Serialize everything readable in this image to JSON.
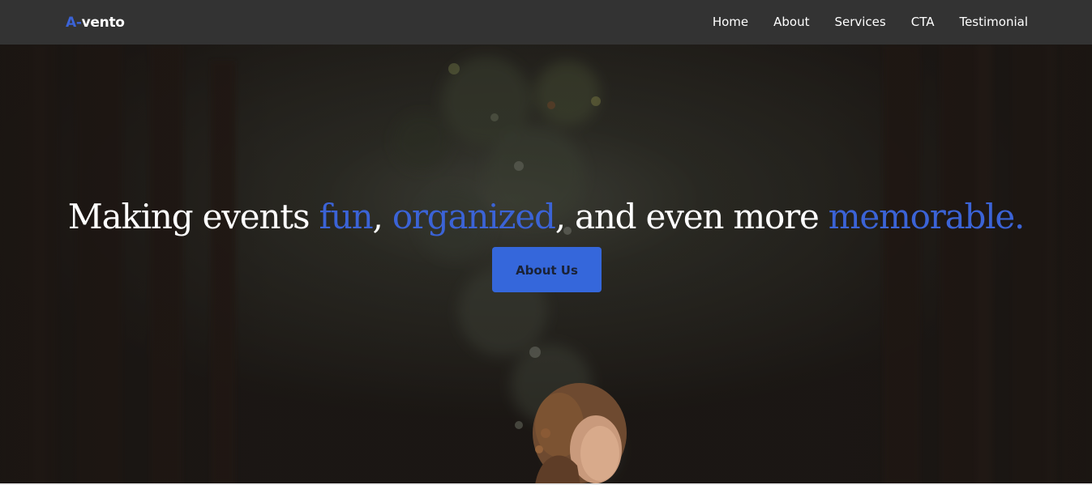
{
  "brand": {
    "prefix": "A-",
    "name": "vento",
    "accent_color": "#3b63d6"
  },
  "nav": {
    "items": [
      {
        "label": "Home"
      },
      {
        "label": "About"
      },
      {
        "label": "Services"
      },
      {
        "label": "CTA"
      },
      {
        "label": "Testimonial"
      }
    ]
  },
  "hero": {
    "headline": {
      "part1": "Making events ",
      "highlight1": "fun",
      "sep1": ", ",
      "highlight2": "organized",
      "part2": ", and even more ",
      "highlight3": "memorable."
    },
    "button_label": "About Us",
    "button_color": "#3567db",
    "background_image": "forest-path-woman-photo"
  }
}
